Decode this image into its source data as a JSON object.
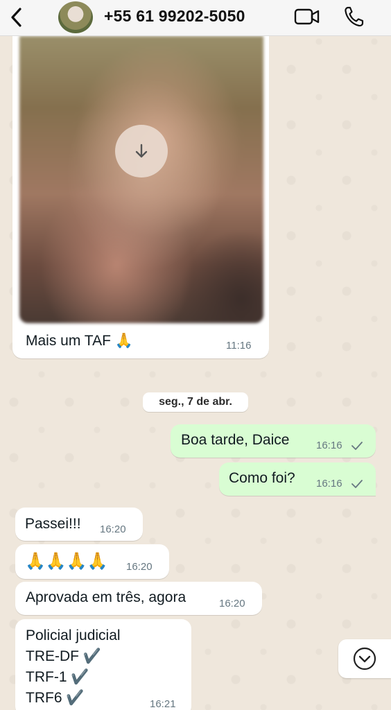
{
  "header": {
    "contact_name": "+55 61 99202-5050",
    "back_icon": "chevron-left-icon",
    "video_icon": "video-camera-icon",
    "call_icon": "phone-icon"
  },
  "messages": {
    "image_caption": "Mais um TAF 🙏",
    "image_time": "11:16",
    "date_separator": "seg., 7 de abr.",
    "out1_text": "Boa tarde, Daice",
    "out1_time": "16:16",
    "out2_text": "Como foi?",
    "out2_time": "16:16",
    "in1_text": "Passei!!!",
    "in1_time": "16:20",
    "in2_text": "🙏🙏🙏🙏",
    "in2_time": "16:20",
    "in3_text": "Aprovada em três, agora",
    "in3_time": "16:20",
    "in4_line1": "Policial judicial",
    "in4_line2": "TRE-DF ✔️",
    "in4_line3": "TRF-1 ✔️",
    "in4_line4": "TRF6 ✔️",
    "in4_time": "16:21"
  },
  "colors": {
    "outgoing_bubble": "#d9fdd3",
    "incoming_bubble": "#ffffff",
    "read_tick": "#667781"
  }
}
